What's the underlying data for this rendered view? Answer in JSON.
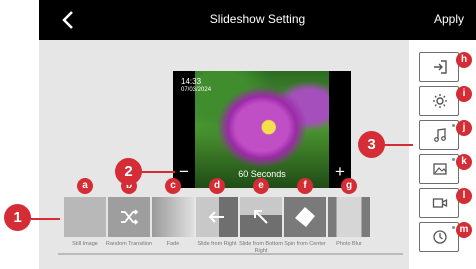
{
  "header": {
    "title": "Slideshow Setting",
    "apply_label": "Apply",
    "back_icon": "chevron-left-icon"
  },
  "preview": {
    "time": "14:33",
    "date": "07/03/2024",
    "duration": "60 Seconds",
    "minus": "−",
    "plus": "+"
  },
  "effects": [
    {
      "label": "Still Image",
      "callout": "a"
    },
    {
      "label": "Random Transition",
      "callout": "b",
      "icon": "shuffle-icon"
    },
    {
      "label": "Fade",
      "callout": "c"
    },
    {
      "label": "Slide from Right",
      "callout": "d",
      "icon": "arrow-left-icon"
    },
    {
      "label": "Slide from Bottom Right",
      "callout": "e",
      "icon": "arrow-up-left-icon"
    },
    {
      "label": "Spin from Center",
      "callout": "f",
      "icon": "diamond-icon"
    },
    {
      "label": "Photo Blur",
      "callout": "g"
    }
  ],
  "sidebar": [
    {
      "name": "exit",
      "callout": "h",
      "icon": "sign-in-icon"
    },
    {
      "name": "brightness",
      "callout": "i",
      "icon": "sun-icon"
    },
    {
      "name": "music",
      "callout": "j",
      "icon": "music-note-icon"
    },
    {
      "name": "photo",
      "callout": "k",
      "icon": "image-icon"
    },
    {
      "name": "video",
      "callout": "l",
      "icon": "video-camera-icon"
    },
    {
      "name": "timer",
      "callout": "m",
      "icon": "clock-icon"
    }
  ],
  "callouts": {
    "one": "1",
    "two": "2",
    "three": "3"
  },
  "colors": {
    "accent": "#d42d35",
    "topbar": "#000000",
    "panel": "#e6e6e6"
  }
}
